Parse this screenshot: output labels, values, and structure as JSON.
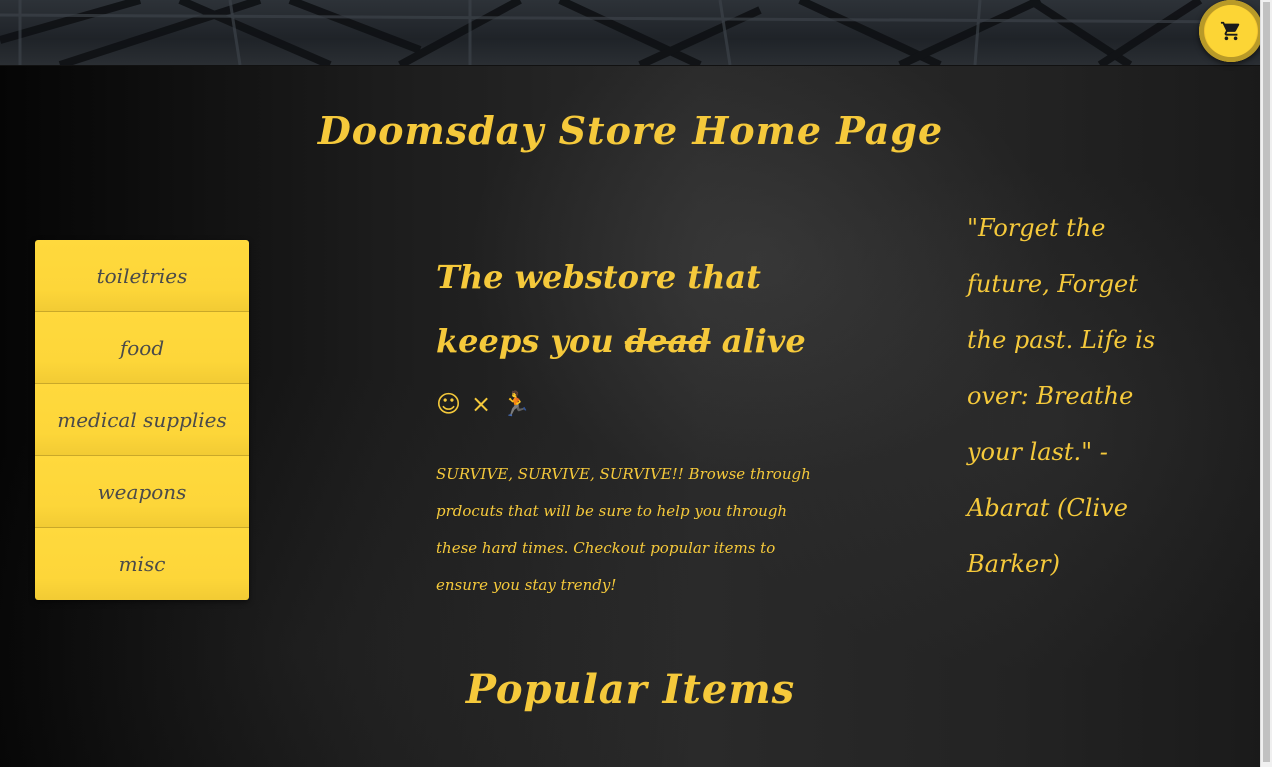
{
  "header": {
    "cart_icon": "shopping-cart-icon"
  },
  "page": {
    "title": "Doomsday Store Home Page"
  },
  "sidebar": {
    "items": [
      {
        "label": "toiletries"
      },
      {
        "label": "food"
      },
      {
        "label": "medical supplies"
      },
      {
        "label": "weapons"
      },
      {
        "label": "misc"
      }
    ]
  },
  "hero": {
    "heading_before": "The webstore that keeps you ",
    "heading_strike": "dead",
    "heading_after": " alive",
    "emoji_smile": "☺",
    "emoji_times": "×",
    "emoji_run": "🏃",
    "text": "SURVIVE, SURVIVE, SURVIVE!! Browse through prdocuts that will be sure to help you through these hard times. Checkout popular items to ensure you stay trendy!"
  },
  "quote": {
    "text": "\"Forget the future, Forget the past. Life is over: Breathe your last.\" -Abarat (Clive Barker)"
  },
  "popular": {
    "title": "Popular Items"
  },
  "colors": {
    "accent": "#f5c93b",
    "menu_bg": "#ffd93d",
    "menu_text": "#4a4a4a",
    "background": "#1e1e1e"
  }
}
